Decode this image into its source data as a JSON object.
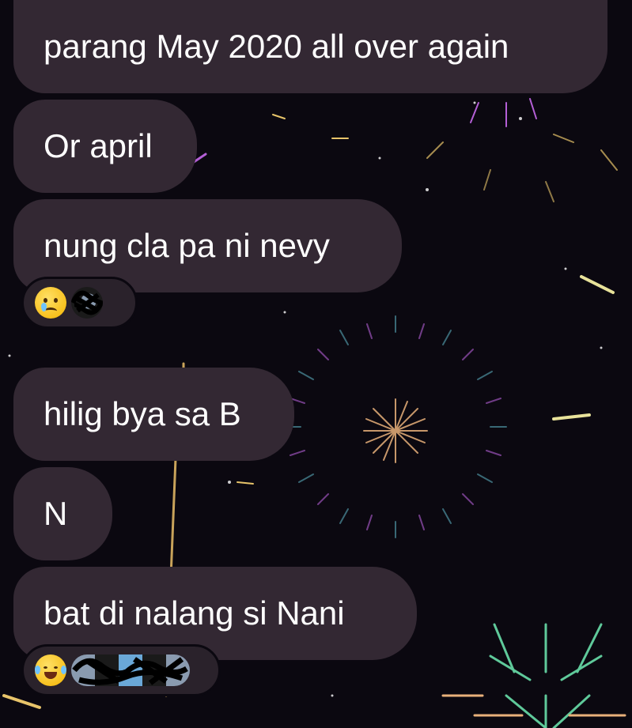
{
  "messages": [
    {
      "text": "parang May 2020 all over again"
    },
    {
      "text": "Or april"
    },
    {
      "text": "nung cla pa ni nevy"
    },
    {
      "text": "hilig bya sa B"
    },
    {
      "text": "N"
    },
    {
      "text": "bat di nalang si Nani"
    }
  ],
  "reactions": [
    {
      "emoji": "crying-face-emoji",
      "avatars": [
        "redacted-avatar"
      ]
    },
    {
      "emoji": "tears-of-joy-emoji",
      "avatars": [
        "redacted-avatar",
        "redacted-avatar",
        "redacted-avatar"
      ]
    }
  ],
  "colors": {
    "background": "#0b0810",
    "bubble": "#332833",
    "text": "#ffffff",
    "firework_purple": "#b45fd6",
    "firework_teal": "#5fb8c9",
    "firework_gold": "#e8c46a"
  }
}
